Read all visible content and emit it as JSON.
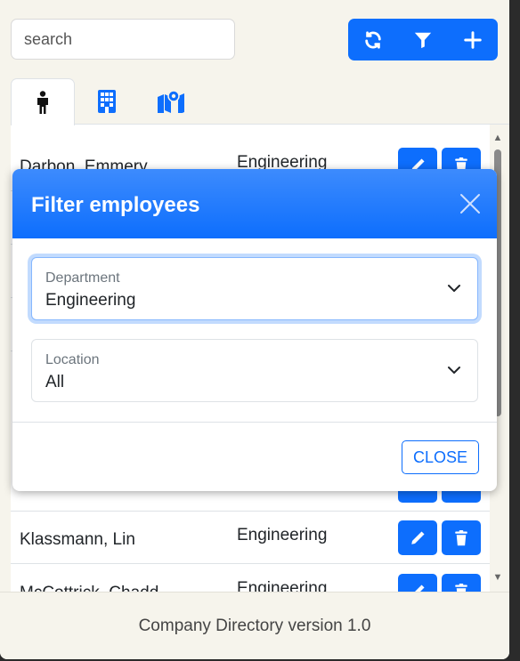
{
  "search": {
    "placeholder": "search"
  },
  "toolbar": {
    "buttons": [
      "refresh-icon",
      "filter-icon",
      "plus-icon"
    ]
  },
  "tabs": {
    "items": [
      {
        "icon": "person-icon",
        "active": true
      },
      {
        "icon": "building-icon",
        "active": false
      },
      {
        "icon": "map-location-icon",
        "active": false
      }
    ]
  },
  "employees": {
    "rows": [
      {
        "name": "Darbon, Emmery",
        "department": "Engineering"
      },
      {
        "name": "",
        "department": ""
      },
      {
        "name": "",
        "department": ""
      },
      {
        "name": "",
        "department": ""
      },
      {
        "name": "",
        "department": ""
      },
      {
        "name": "Klassmann, Lin",
        "department": "Engineering"
      },
      {
        "name": "McCottrick, Chadd",
        "department": "Engineering"
      }
    ]
  },
  "footer": {
    "text": "Company Directory version 1.0"
  },
  "filter_modal": {
    "title": "Filter employees",
    "department": {
      "label": "Department",
      "value": "Engineering"
    },
    "location": {
      "label": "Location",
      "value": "All"
    },
    "close_label": "CLOSE"
  },
  "colors": {
    "primary": "#0d6efd",
    "background": "#f6f4ec"
  }
}
